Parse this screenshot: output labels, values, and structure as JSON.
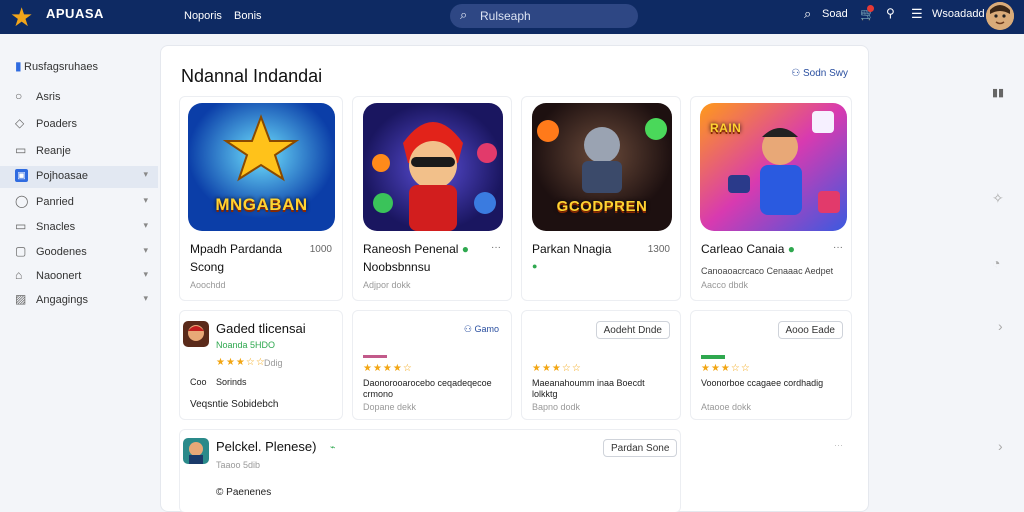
{
  "header": {
    "logo_text": "APUASA",
    "nav": [
      "Noporis",
      "Bonis"
    ],
    "search_placeholder": "Rulseaph",
    "right_label_1": "Soad",
    "right_label_2": "Wsoadadd"
  },
  "sidebar": {
    "items": [
      {
        "label": "Rusfagsruhaes",
        "icon": "app-icon"
      },
      {
        "label": "Asris",
        "icon": "circle-icon"
      },
      {
        "label": "Poaders",
        "icon": "tag-icon"
      },
      {
        "label": "Reanje",
        "icon": "chat-icon"
      },
      {
        "label": "Pojhoasae",
        "icon": "grid-icon",
        "active": true
      },
      {
        "label": "Panried",
        "icon": "bubble-icon"
      },
      {
        "label": "Snacles",
        "icon": "card-icon"
      },
      {
        "label": "Goodenes",
        "icon": "folder-icon"
      },
      {
        "label": "Naoonert",
        "icon": "home-icon"
      },
      {
        "label": "Angagings",
        "icon": "image-icon"
      }
    ]
  },
  "panel": {
    "title": "Ndannal Indandai",
    "link": "Sodn Swy"
  },
  "top_cards": [
    {
      "art": "MNGABAN",
      "title": "Mpadh Pardanda",
      "subtitle": "Scong",
      "num": "1000",
      "meta": "Aoochdd"
    },
    {
      "art": "",
      "title": "Raneosh Penenal",
      "subtitle": "Noobsbnnsu",
      "num": "",
      "meta": "Adjpor dokk"
    },
    {
      "art": "GCODPREN",
      "title": "Parkan Nnagia",
      "subtitle": "",
      "num": "1300",
      "meta": ""
    },
    {
      "art": "RAIN",
      "title": "Carleao Canaia",
      "subtitle": "Canoaoacrcaco Cenaaac Aedpet",
      "num": "",
      "meta": "Aacco dbdk"
    }
  ],
  "mid_cards": [
    {
      "title": "Gaded tlicensai",
      "green": "Noanda 5HDO",
      "stars": "★★★☆☆",
      "count": "Ddig",
      "line1": "Coo",
      "line2": "Sorinds",
      "foot": "Veqsntie Sobidebch"
    },
    {
      "btn": "Gamo",
      "stars": "★★★★☆",
      "desc": "Daonorooarocebo ceqadeqecoe crmono",
      "meta": "Dopane dekk"
    },
    {
      "btn": "Aodeht Dnde",
      "stars": "★★★☆☆",
      "desc": "Maeanahoumm inaa Boecdt lolkktg",
      "meta": "Bapno dodk"
    },
    {
      "btn": "Aooo Eade",
      "stars": "★★★☆☆",
      "desc": "Voonorboe ccagaee cordhadig",
      "meta": "Ataooe dokk"
    }
  ],
  "bottom_card": {
    "title": "Pelckel. Plenese)",
    "green": "Taaoo 5dib",
    "foot": "Paenenes",
    "btn": "Pardan Sone"
  }
}
